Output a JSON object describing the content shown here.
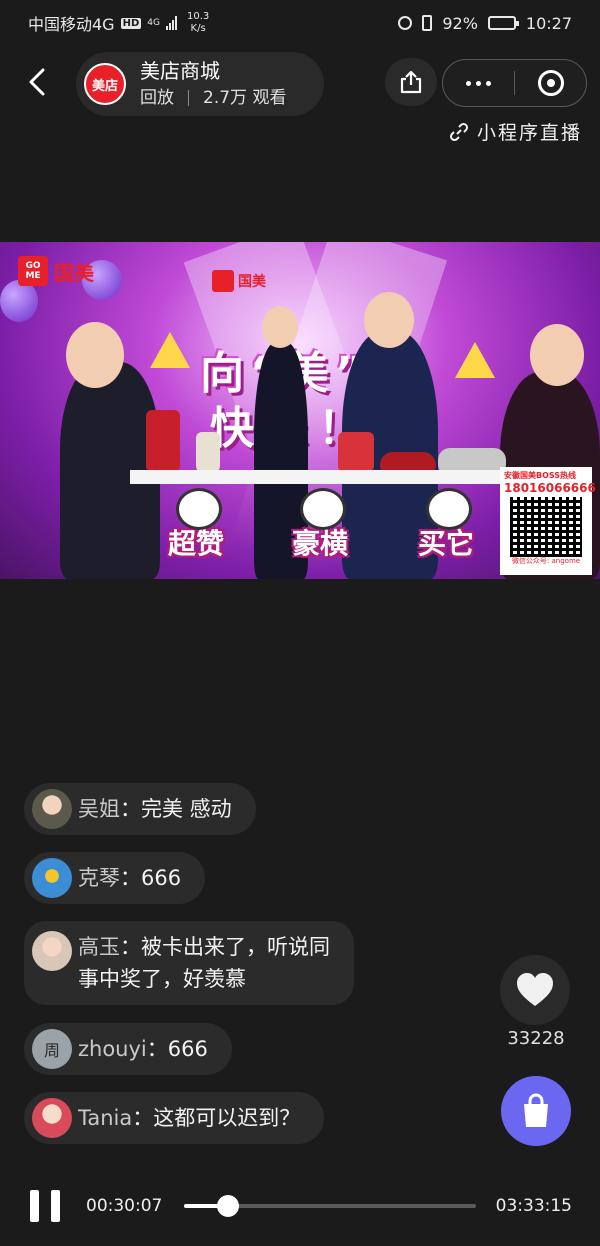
{
  "status_bar": {
    "carrier": "中国移动4G",
    "hd": "HD",
    "network": "4G",
    "net_speed_value": "10.3",
    "net_speed_unit": "K/s",
    "battery_pct": "92%",
    "battery_level": 0.92,
    "time": "10:27"
  },
  "header": {
    "logo_text": "美店",
    "room_name": "美店商城",
    "replay_label": "回放",
    "viewers": "2.7万 观看",
    "mini_program_live": "小程序直播"
  },
  "icons": {
    "back": "chevron-left",
    "share": "share-box",
    "more": "three-dots",
    "close": "target-circle",
    "link": "link",
    "like": "heart",
    "cart": "shopping-bag"
  },
  "video": {
    "brand": "国美",
    "brand_badge": "GO ME",
    "banner_line1": "向“美”而",
    "banner_line2": "快乐！",
    "stickers": [
      "超赞",
      "豪横",
      "买它"
    ],
    "hotline": "安徽国美BOSS热线",
    "phone": "18016066666",
    "wechat": "微信公众号: angome"
  },
  "comments": [
    {
      "user": "吴姐",
      "message": "完美 感动",
      "avatar_color": "#8a8d72"
    },
    {
      "user": "克琴",
      "message": "666",
      "avatar_color": "#3b8ed6"
    },
    {
      "user": "高玉",
      "message": "被卡出来了，听说同",
      "message_line2": "事中奖了，好羡慕",
      "avatar_color": "#d8c6b8"
    },
    {
      "user": "zhouyi",
      "message": "666",
      "avatar_color": "#9aa4a8",
      "avatar_char": "周"
    },
    {
      "user": "Tania",
      "message": "这都可以迟到？",
      "avatar_color": "#d94a5a"
    }
  ],
  "like_count": "33228",
  "player": {
    "current_time": "00:30:07",
    "total_time": "03:33:15",
    "progress": 0.15
  },
  "colors": {
    "background": "#1b1b1b",
    "cart_accent": "#6b67f0",
    "brand_red": "#e8202a"
  }
}
